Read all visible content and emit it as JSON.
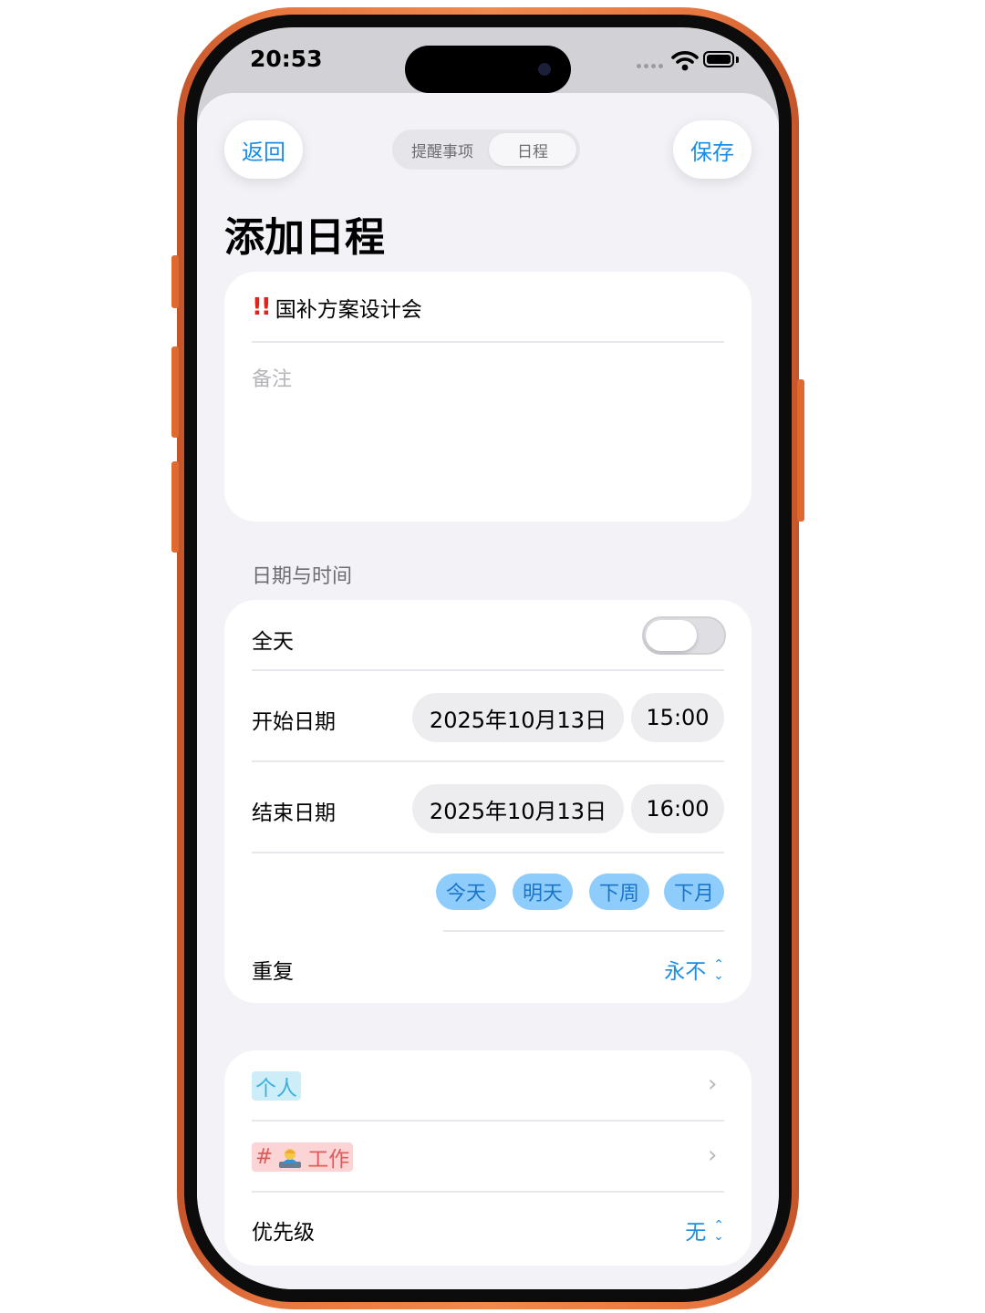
{
  "status_bar": {
    "time": "20:53"
  },
  "nav": {
    "back_label": "返回",
    "save_label": "保存",
    "segments": [
      "提醒事项",
      "日程"
    ],
    "selected_segment": "日程"
  },
  "page_title": "添加日程",
  "event": {
    "priority_marks": "!!",
    "title": "国补方案设计会",
    "notes_placeholder": "备注"
  },
  "date_section": {
    "label": "日期与时间",
    "all_day": {
      "label": "全天",
      "on": false
    },
    "start": {
      "label": "开始日期",
      "date": "2025年10月13日",
      "time": "15:00"
    },
    "end": {
      "label": "结束日期",
      "date": "2025年10月13日",
      "time": "16:00"
    },
    "quick_picks": [
      "今天",
      "明天",
      "下周",
      "下月"
    ],
    "repeat": {
      "label": "重复",
      "value": "永不"
    }
  },
  "details": {
    "calendar": "个人",
    "tag_hash": "#",
    "tag_name": "工作",
    "tag_icon": "technologist-emoji",
    "priority": {
      "label": "优先级",
      "value": "无"
    }
  },
  "colors": {
    "accent": "#1a8ee6",
    "frame": "#e8763f",
    "priority_mark": "#e0241c",
    "quick_pick_bg": "#8ecdfb",
    "calendar_tag_bg": "#cdeef9",
    "work_tag_bg": "#fbd5d5"
  }
}
